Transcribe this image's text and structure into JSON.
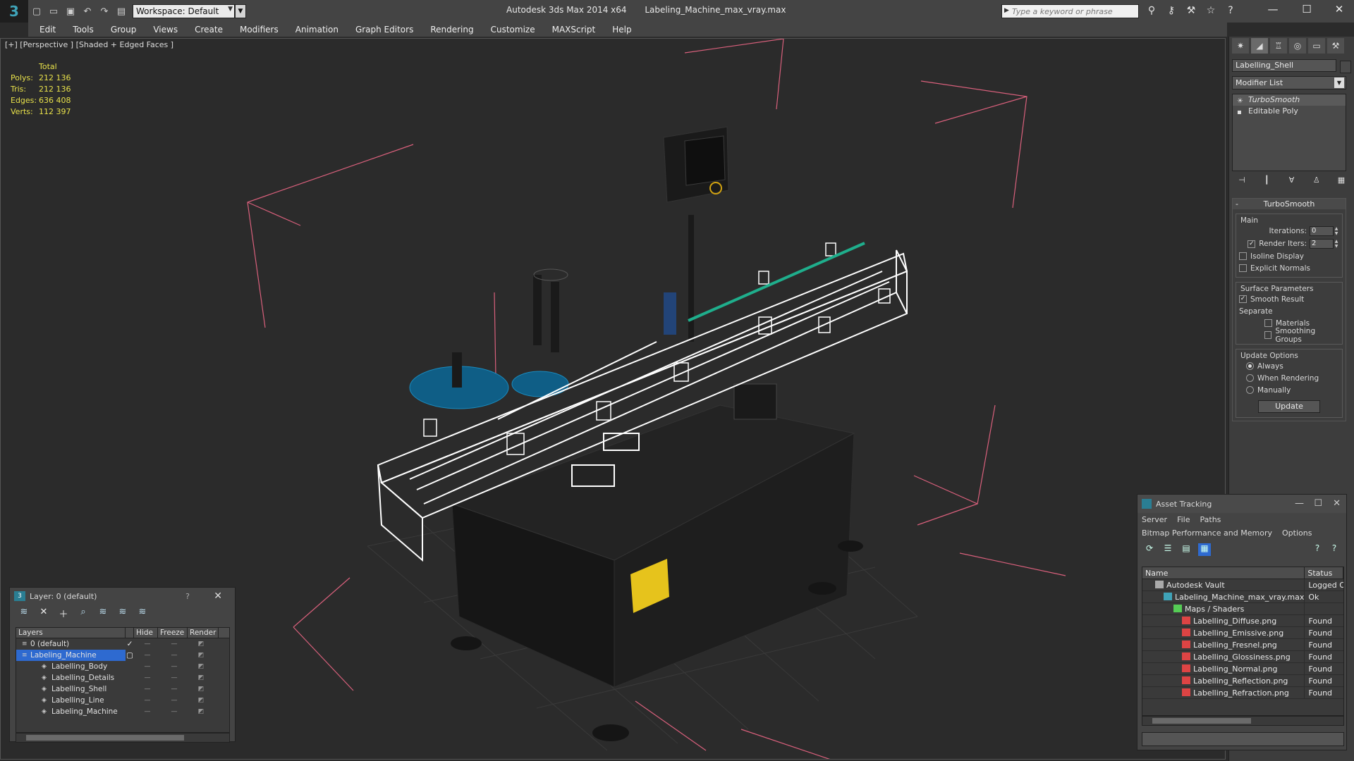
{
  "titlebar": {
    "app_name": "Autodesk 3ds Max  2014 x64",
    "file_name": "Labeling_Machine_max_vray.max",
    "workspace": "Workspace: Default",
    "search_placeholder": "Type a keyword or phrase"
  },
  "menu": [
    "Edit",
    "Tools",
    "Group",
    "Views",
    "Create",
    "Modifiers",
    "Animation",
    "Graph Editors",
    "Rendering",
    "Customize",
    "MAXScript",
    "Help"
  ],
  "viewport": {
    "label": "[+] [Perspective ] [Shaded + Edged Faces ]",
    "stats": {
      "header": "Total",
      "rows": [
        {
          "k": "Polys:",
          "v": "212 136"
        },
        {
          "k": "Tris:",
          "v": "212 136"
        },
        {
          "k": "Edges:",
          "v": "636 408"
        },
        {
          "k": "Verts:",
          "v": "112 397"
        }
      ]
    }
  },
  "command_panel": {
    "object_name": "Labelling_Shell",
    "modifier_list": "Modifier List",
    "stack": [
      "TurboSmooth",
      "Editable Poly"
    ],
    "rollout_title": "TurboSmooth",
    "main_group": "Main",
    "iterations_label": "Iterations:",
    "iterations_value": "0",
    "render_iters_label": "Render Iters:",
    "render_iters_value": "2",
    "isoline_display": "Isoline Display",
    "explicit_normals": "Explicit Normals",
    "surface_group": "Surface Parameters",
    "smooth_result": "Smooth Result",
    "separate_label": "Separate",
    "materials": "Materials",
    "smoothing_groups": "Smoothing Groups",
    "update_group": "Update Options",
    "always": "Always",
    "when_rendering": "When Rendering",
    "manually": "Manually",
    "update_button": "Update"
  },
  "layer_dialog": {
    "title": "Layer: 0 (default)",
    "help": "?",
    "columns": [
      "Layers",
      "Hide",
      "Freeze",
      "Render"
    ],
    "rows": [
      {
        "name": "0 (default)",
        "child": false,
        "selected": false
      },
      {
        "name": "Labeling_Machine",
        "child": false,
        "selected": true
      },
      {
        "name": "Labelling_Body",
        "child": true,
        "selected": false
      },
      {
        "name": "Labelling_Details",
        "child": true,
        "selected": false
      },
      {
        "name": "Labelling_Shell",
        "child": true,
        "selected": false
      },
      {
        "name": "Labelling_Line",
        "child": true,
        "selected": false
      },
      {
        "name": "Labeling_Machine",
        "child": true,
        "selected": false
      }
    ]
  },
  "asset_dialog": {
    "title": "Asset Tracking",
    "menu1": [
      "Server",
      "File",
      "Paths"
    ],
    "menu2": [
      "Bitmap Performance and Memory",
      "Options"
    ],
    "columns": [
      "Name",
      "Status"
    ],
    "rows": [
      {
        "name": "Autodesk Vault",
        "status": "Logged O",
        "level": 1,
        "icon": "vault-icon"
      },
      {
        "name": "Labeling_Machine_max_vray.max",
        "status": "Ok",
        "level": 2,
        "icon": "max-file-icon"
      },
      {
        "name": "Maps / Shaders",
        "status": "",
        "level": 3,
        "icon": "maps-icon"
      },
      {
        "name": "Labelling_Diffuse.png",
        "status": "Found",
        "level": 4,
        "icon": "png-icon"
      },
      {
        "name": "Labelling_Emissive.png",
        "status": "Found",
        "level": 4,
        "icon": "png-icon"
      },
      {
        "name": "Labelling_Fresnel.png",
        "status": "Found",
        "level": 4,
        "icon": "png-icon"
      },
      {
        "name": "Labelling_Glossiness.png",
        "status": "Found",
        "level": 4,
        "icon": "png-icon"
      },
      {
        "name": "Labelling_Normal.png",
        "status": "Found",
        "level": 4,
        "icon": "png-icon"
      },
      {
        "name": "Labelling_Reflection.png",
        "status": "Found",
        "level": 4,
        "icon": "png-icon"
      },
      {
        "name": "Labelling_Refraction.png",
        "status": "Found",
        "level": 4,
        "icon": "png-icon"
      }
    ]
  },
  "colors": {
    "stats_yellow": "#e8e14a",
    "selection_blue": "#2e6ad0",
    "bbox_pink": "#d9607c",
    "conveyor_white": "#ffffff",
    "accent_teal": "#1fae8c"
  }
}
